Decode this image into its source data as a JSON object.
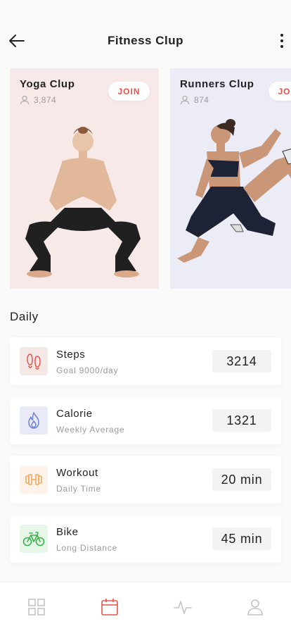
{
  "header": {
    "title": "Fitness Clup"
  },
  "clubs": [
    {
      "name": "Yoga Clup",
      "members": "3,874",
      "join_label": "JOIN"
    },
    {
      "name": "Runners Clup",
      "members": "874",
      "join_label": "JOIN"
    }
  ],
  "daily": {
    "section_title": "Daily",
    "stats": [
      {
        "title": "Steps",
        "subtitle": "Goal 9000/day",
        "value": "3214",
        "icon": "footprints-icon",
        "color": "#e5534b"
      },
      {
        "title": "Calorie",
        "subtitle": "Weekly Average",
        "value": "1321",
        "icon": "flame-icon",
        "color": "#6a7fd6"
      },
      {
        "title": "Workout",
        "subtitle": "Daily Time",
        "value": "20 min",
        "icon": "dumbbell-icon",
        "color": "#f2a65a"
      },
      {
        "title": "Bike",
        "subtitle": "Long Distance",
        "value": "45 min",
        "icon": "bicycle-icon",
        "color": "#3ab54a"
      }
    ]
  },
  "tabbar": {
    "items": [
      "grid-icon",
      "calendar-icon",
      "activity-icon",
      "profile-icon"
    ],
    "active_color": "#e5534b",
    "inactive_color": "#c4c4c4"
  }
}
